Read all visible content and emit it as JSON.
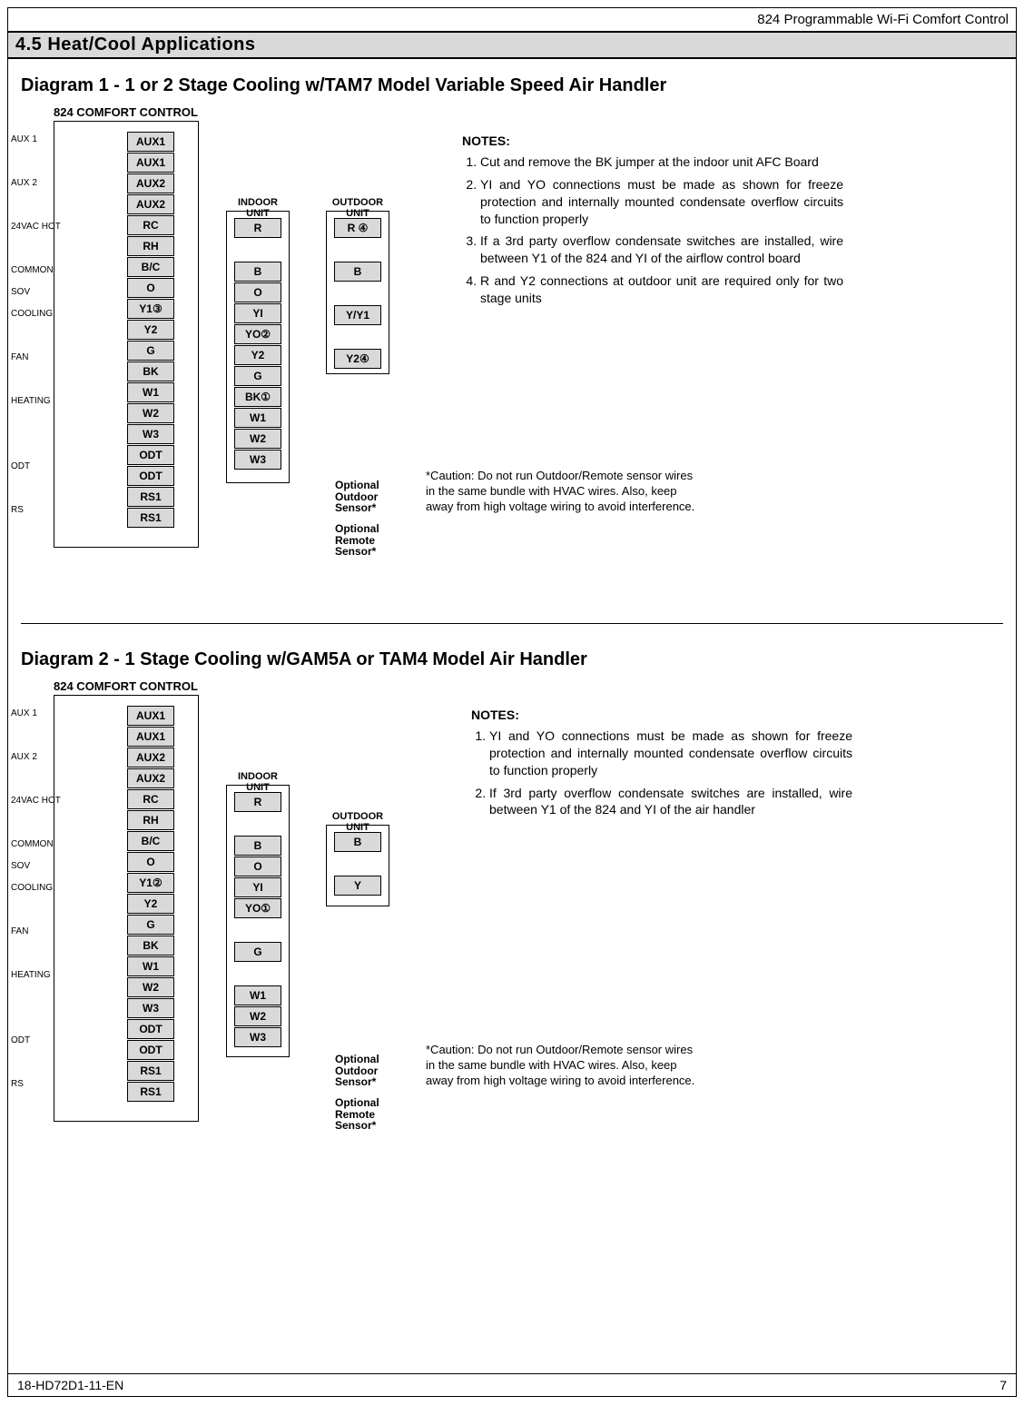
{
  "header_right": "824 Programmable Wi-Fi Comfort Control",
  "section": "4.5   Heat/Cool Applications",
  "footer_left": "18-HD72D1-11-EN",
  "footer_right": "7",
  "diagram1": {
    "title": "Diagram 1 - 1 or 2 Stage Cooling w/TAM7 Model Variable Speed Air Handler",
    "cc_title": "824 COMFORT CONTROL",
    "row_labels": [
      "AUX 1",
      "",
      "AUX 2",
      "",
      "24VAC HOT",
      "",
      "COMMON",
      "SOV",
      "COOLING",
      "",
      "FAN",
      "",
      "HEATING",
      "",
      "",
      "ODT",
      "",
      "RS",
      ""
    ],
    "cc_terms": [
      "AUX1",
      "AUX1",
      "AUX2",
      "AUX2",
      "RC",
      "RH",
      "B/C",
      "O",
      "Y1③",
      "Y2",
      "G",
      "BK",
      "W1",
      "W2",
      "W3",
      "ODT",
      "ODT",
      "RS1",
      "RS1"
    ],
    "indoor_title": "INDOOR UNIT",
    "indoor_terms": [
      "R",
      "",
      "B",
      "O",
      "YI",
      "YO②",
      "Y2",
      "G",
      "BK①",
      "W1",
      "W2",
      "W3"
    ],
    "outdoor_title": "OUTDOOR UNIT",
    "outdoor_terms": [
      "R ④",
      "",
      "B",
      "",
      "Y/Y1",
      "",
      "Y2④"
    ],
    "sensor1": "Optional\nOutdoor\nSensor*",
    "sensor2": "Optional\nRemote\nSensor*",
    "notes_hd": "NOTES:",
    "notes": [
      "Cut and remove the BK jumper at the indoor unit AFC Board",
      "YI and YO connections must be made as shown for freeze protection and internally mounted condensate overflow circuits to function properly",
      "If a 3rd party overflow condensate switches are installed, wire between Y1 of the 824 and YI of the airflow control board",
      "R and Y2 connections at outdoor unit are required only for two stage units"
    ],
    "caution": "*Caution: Do not run Outdoor/Remote sensor wires in the same bundle with HVAC wires. Also, keep away from high voltage wiring to avoid interference."
  },
  "diagram2": {
    "title": "Diagram 2 - 1 Stage Cooling w/GAM5A or TAM4 Model Air Handler",
    "cc_title": "824 COMFORT CONTROL",
    "row_labels": [
      "AUX 1",
      "",
      "AUX 2",
      "",
      "24VAC HOT",
      "",
      "COMMON",
      "SOV",
      "COOLING",
      "",
      "FAN",
      "",
      "HEATING",
      "",
      "",
      "ODT",
      "",
      "RS",
      ""
    ],
    "cc_terms": [
      "AUX1",
      "AUX1",
      "AUX2",
      "AUX2",
      "RC",
      "RH",
      "B/C",
      "O",
      "Y1②",
      "Y2",
      "G",
      "BK",
      "W1",
      "W2",
      "W3",
      "ODT",
      "ODT",
      "RS1",
      "RS1"
    ],
    "indoor_title": "INDOOR UNIT",
    "indoor_terms": [
      "R",
      "",
      "B",
      "O",
      "YI",
      "YO①",
      "",
      "G",
      "",
      "W1",
      "W2",
      "W3"
    ],
    "outdoor_title": "OUTDOOR UNIT",
    "outdoor_terms": [
      "B",
      "",
      "Y"
    ],
    "sensor1": "Optional\nOutdoor\nSensor*",
    "sensor2": "Optional\nRemote\nSensor*",
    "notes_hd": "NOTES:",
    "notes": [
      "YI and YO connections must be made as shown for freeze protection and internally mounted condensate overflow circuits to function properly",
      "If 3rd party overflow condensate switches are installed, wire between Y1 of the 824 and YI of the air handler"
    ],
    "caution": "*Caution: Do not run Outdoor/Remote sensor wires in the same bundle with HVAC wires. Also, keep away from high voltage wiring to avoid interference."
  }
}
